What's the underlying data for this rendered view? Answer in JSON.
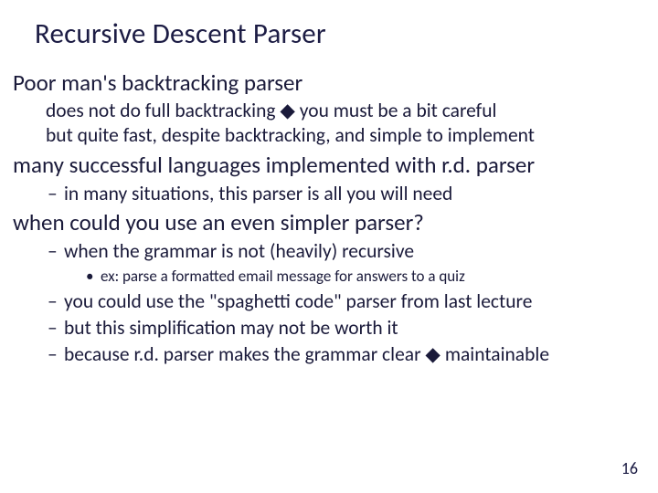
{
  "title": "Recursive Descent Parser",
  "sections": [
    {
      "heading": "Poor man's backtracking parser",
      "sub_a": "does not do full backtracking  ◆  you must be a bit careful",
      "sub_b": "but quite fast, despite backtracking, and simple to implement"
    },
    {
      "heading": "many successful languages implemented with r.d. parser",
      "dash_a": "in many situations, this parser is all you will need"
    },
    {
      "heading": "when could you use an even simpler parser?",
      "dash_a": "when the grammar is not (heavily) recursive",
      "bullet_a": "ex: parse a formatted email message for answers to a quiz",
      "dash_b": "you could use the \"spaghetti code\" parser from last lecture",
      "dash_c": "but this simplification may not be worth it",
      "dash_d": "because r.d. parser makes the grammar clear ◆ maintainable"
    }
  ],
  "page_number": "16",
  "glyphs": {
    "dash": "–",
    "dot": "•"
  }
}
